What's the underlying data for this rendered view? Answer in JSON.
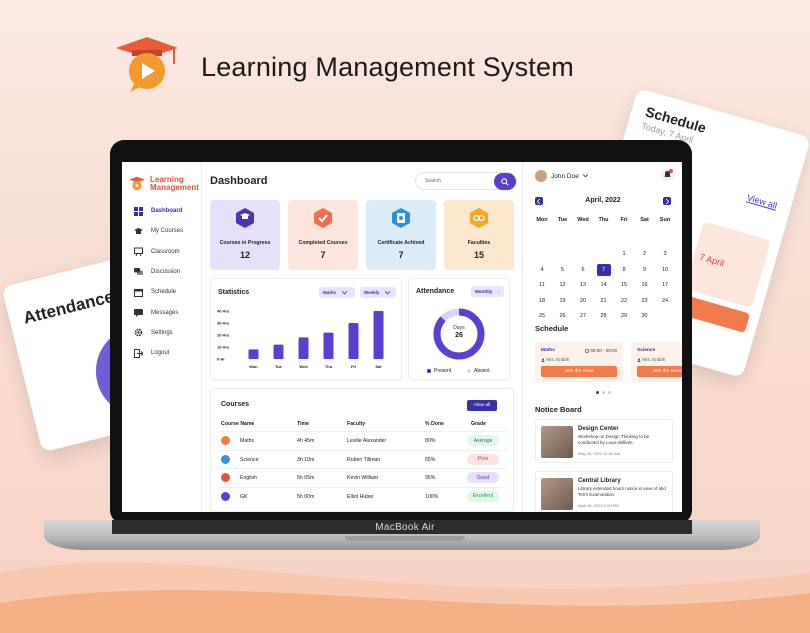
{
  "brand": {
    "title": "Learning Management System"
  },
  "bg_cards": {
    "attendance_title": "Attendance",
    "schedule_title": "Schedule",
    "schedule_sub": "Today, 7 April",
    "schedule_view_all": "View all",
    "schedule_date_fragment": "7 April"
  },
  "laptop": {
    "model_label": "MacBook Air"
  },
  "sidebar": {
    "logo_line1": "Learning",
    "logo_line2": "Management",
    "items": [
      {
        "label": "Dashboard",
        "icon": "grid-icon"
      },
      {
        "label": "My Courses",
        "icon": "graduation-cap-icon"
      },
      {
        "label": "Classroom",
        "icon": "chalkboard-icon"
      },
      {
        "label": "Discussion",
        "icon": "chat-icon"
      },
      {
        "label": "Schedule",
        "icon": "calendar-icon"
      },
      {
        "label": "Messages",
        "icon": "message-icon"
      },
      {
        "label": "Settings",
        "icon": "gear-icon"
      },
      {
        "label": "Logout",
        "icon": "logout-icon"
      }
    ]
  },
  "header": {
    "title": "Dashboard",
    "search_placeholder": "Search"
  },
  "stats": [
    {
      "label": "Courses in Progress",
      "value": "12",
      "bg": "#e6e0fb",
      "accent": "#4b35b5"
    },
    {
      "label": "Completed Courses",
      "value": "7",
      "bg": "#fde5de",
      "accent": "#ee6f4c"
    },
    {
      "label": "Certificate Achived",
      "value": "7",
      "bg": "#dcebf8",
      "accent": "#2b8fe0"
    },
    {
      "label": "Faculties",
      "value": "15",
      "bg": "#fde7cf",
      "accent": "#f5a623"
    }
  ],
  "statistics": {
    "title": "Statistics",
    "filter_subject": "Maths",
    "filter_period": "Weekly"
  },
  "chart_data": {
    "type": "bar",
    "categories": [
      "Mon",
      "Tue",
      "Wed",
      "Thu",
      "Fri",
      "Sat"
    ],
    "values": [
      8,
      12,
      18,
      22,
      30,
      40
    ],
    "yticks": [
      "40 Hrs",
      "30 Hrs",
      "20 Hrs",
      "10 Hrs",
      "0 Hr"
    ],
    "ylim": [
      0,
      40
    ],
    "color": "#5b3fd0"
  },
  "attendance": {
    "title": "Attendance",
    "filter": "Monthly",
    "center_label": "Days",
    "center_value": "26",
    "present_fraction": 0.87,
    "legend_present": "Present",
    "legend_absent": "Absent"
  },
  "courses": {
    "title": "Courses",
    "view_all": "View all",
    "headers": [
      "Course Name",
      "Time",
      "Faculty",
      "% Done",
      "Grade"
    ],
    "rows": [
      {
        "name": "Maths",
        "time": "4h 45m",
        "faculty": "Lesilie Alexander",
        "done": "80%",
        "grade": "Average",
        "grade_bg": "#e3f5ee",
        "grade_fg": "#2a7a5a"
      },
      {
        "name": "Science",
        "time": "3h 10m",
        "faculty": "Ruben Tillman",
        "done": "65%",
        "grade": "Poor",
        "grade_bg": "#fde3e3",
        "grade_fg": "#d04141"
      },
      {
        "name": "English",
        "time": "5h 05m",
        "faculty": "Kevin William",
        "done": "95%",
        "grade": "Good",
        "grade_bg": "#e6e0fb",
        "grade_fg": "#4b35b5"
      },
      {
        "name": "GK",
        "time": "5h 00m",
        "faculty": "Elliot Huber",
        "done": "100%",
        "grade": "Excellent",
        "grade_bg": "#def7e4",
        "grade_fg": "#2e9a4b"
      }
    ]
  },
  "user": {
    "name": "John Doe"
  },
  "calendar": {
    "title": "April, 2022",
    "days": [
      "Mon",
      "Tue",
      "Wed",
      "Thu",
      "Fri",
      "Sat",
      "Sun"
    ],
    "weeks": [
      [
        "",
        "",
        "",
        "",
        "1",
        "2",
        "3"
      ],
      [
        "4",
        "5",
        "6",
        "7",
        "8",
        "9",
        "10"
      ],
      [
        "11",
        "12",
        "13",
        "14",
        "15",
        "16",
        "17"
      ],
      [
        "18",
        "19",
        "20",
        "21",
        "22",
        "23",
        "24"
      ],
      [
        "25",
        "26",
        "27",
        "28",
        "29",
        "30",
        ""
      ]
    ],
    "selected": "7"
  },
  "schedule": {
    "title": "Schedule",
    "cards": [
      {
        "subject": "Maths",
        "time": "08:00 - 09:00",
        "teacher": "Mrs. Endah",
        "button": "Join the class"
      },
      {
        "subject": "Science",
        "time": "",
        "teacher": "Mrs. Endah",
        "button": "Join the class"
      }
    ]
  },
  "notice_board": {
    "title": "Notice Board",
    "items": [
      {
        "title": "Design Center",
        "text": "Workshop on Design Thinking to be conducted by Louis William.",
        "date": "May 05, 2022  11:00 AM"
      },
      {
        "title": "Central Library",
        "text": "Library extended hours notice in view of Mid Term Examination.",
        "date": "April 28, 2022  2:00 PM"
      }
    ]
  }
}
